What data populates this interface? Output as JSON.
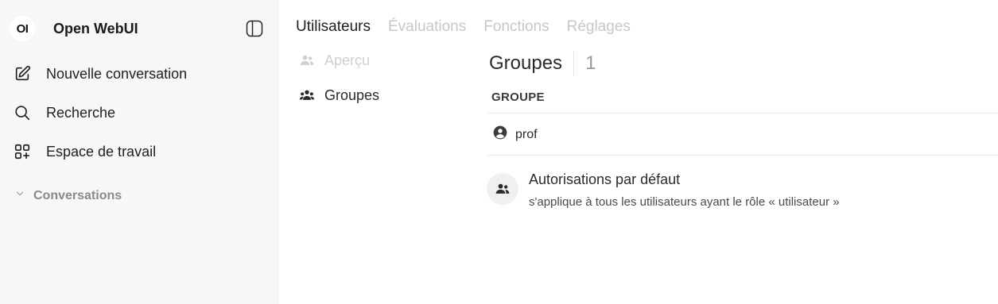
{
  "sidebar": {
    "logo_text": "OI",
    "app_name": "Open WebUI",
    "items": [
      {
        "label": "Nouvelle conversation",
        "icon": "pencil-square-icon"
      },
      {
        "label": "Recherche",
        "icon": "search-icon"
      },
      {
        "label": "Espace de travail",
        "icon": "workspace-grid-icon"
      }
    ],
    "section_label": "Conversations"
  },
  "tabs": [
    {
      "label": "Utilisateurs",
      "active": true
    },
    {
      "label": "Évaluations",
      "active": false
    },
    {
      "label": "Fonctions",
      "active": false
    },
    {
      "label": "Réglages",
      "active": false
    }
  ],
  "subnav": [
    {
      "label": "Aperçu",
      "active": false
    },
    {
      "label": "Groupes",
      "active": true
    }
  ],
  "main": {
    "title": "Groupes",
    "count": "1",
    "column_header": "GROUPE",
    "groups": [
      {
        "name": "prof"
      }
    ],
    "default_permissions": {
      "title": "Autorisations par défaut",
      "description": "s'applique à tous les utilisateurs ayant le rôle « utilisateur »"
    }
  },
  "colors": {
    "sidebar_bg": "#f7f7f7",
    "active_text": "#1f1f1f",
    "inactive_text": "#c7c7c7"
  }
}
